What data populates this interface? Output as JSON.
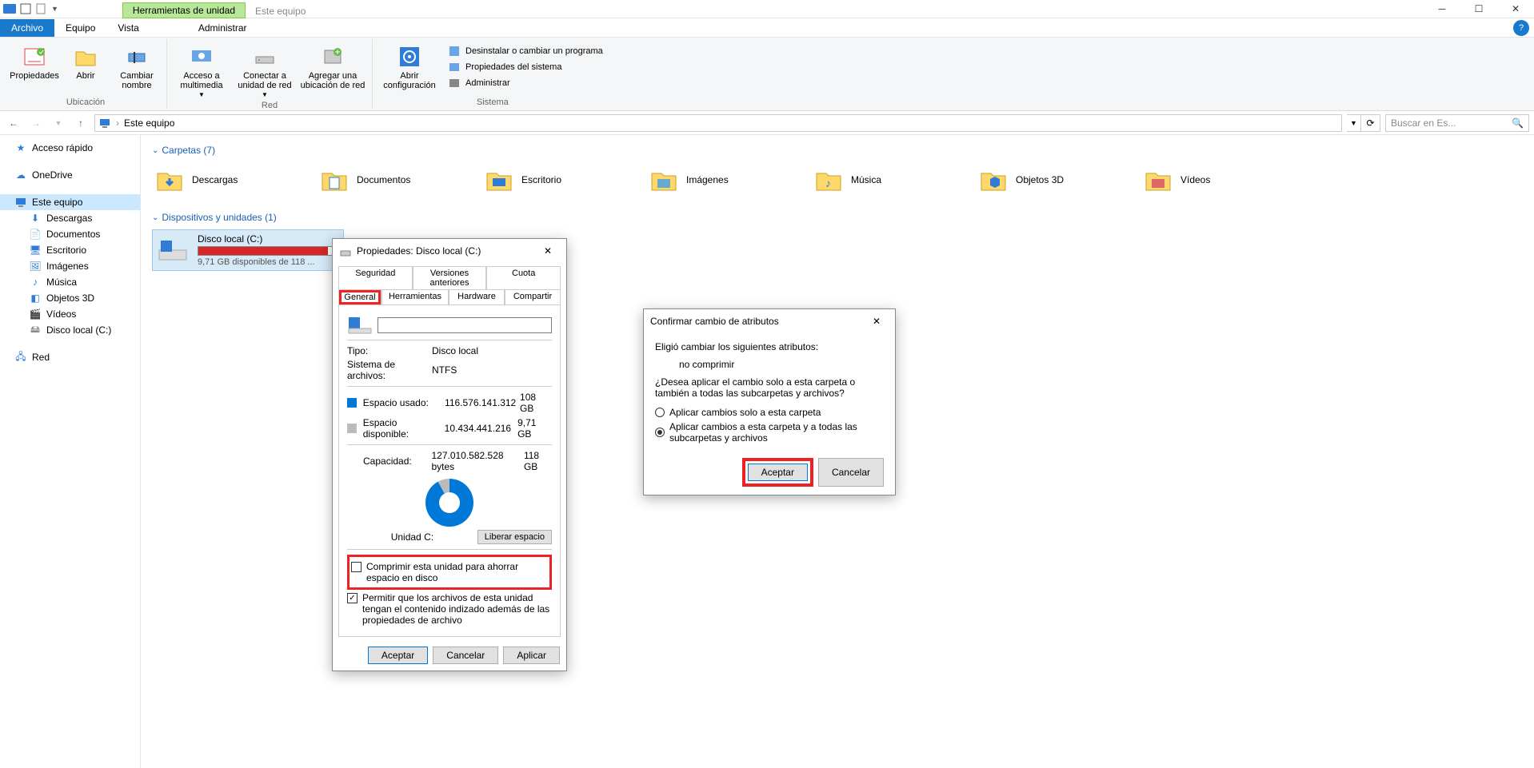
{
  "titlebar": {
    "tools_tab": "Herramientas de unidad",
    "context_label": "Este equipo",
    "manage_label": "Administrar"
  },
  "menutabs": {
    "file": "Archivo",
    "computer": "Equipo",
    "view": "Vista"
  },
  "ribbon": {
    "location": {
      "properties": "Propiedades",
      "open": "Abrir",
      "rename": "Cambiar nombre",
      "group": "Ubicación"
    },
    "network": {
      "media": "Acceso a multimedia",
      "map": "Conectar a unidad de red",
      "add": "Agregar una ubicación de red",
      "group": "Red"
    },
    "system": {
      "settings": "Abrir configuración",
      "uninstall": "Desinstalar o cambiar un programa",
      "sysprops": "Propiedades del sistema",
      "manage": "Administrar",
      "group": "Sistema"
    }
  },
  "address": {
    "crumb": "Este equipo",
    "search_placeholder": "Buscar en Es..."
  },
  "sidebar": {
    "quick": "Acceso rápido",
    "onedrive": "OneDrive",
    "thispc": "Este equipo",
    "downloads": "Descargas",
    "documents": "Documentos",
    "desktop": "Escritorio",
    "pictures": "Imágenes",
    "music": "Música",
    "objects3d": "Objetos 3D",
    "videos": "Vídeos",
    "localdisk": "Disco local (C:)",
    "network": "Red"
  },
  "sections": {
    "folders": "Carpetas (7)",
    "devices": "Dispositivos y unidades (1)"
  },
  "folders": {
    "downloads": "Descargas",
    "documents": "Documentos",
    "desktop": "Escritorio",
    "pictures": "Imágenes",
    "music": "Música",
    "objects3d": "Objetos 3D",
    "videos": "Vídeos"
  },
  "drive": {
    "name": "Disco local (C:)",
    "free": "9,71 GB disponibles de 118 ..."
  },
  "props": {
    "title": "Propiedades: Disco local (C:)",
    "tabs": {
      "security": "Seguridad",
      "prev": "Versiones anteriores",
      "quota": "Cuota",
      "general": "General",
      "tools": "Herramientas",
      "hardware": "Hardware",
      "share": "Compartir"
    },
    "type_label": "Tipo:",
    "type_value": "Disco local",
    "fs_label": "Sistema de archivos:",
    "fs_value": "NTFS",
    "used_label": "Espacio usado:",
    "used_bytes": "116.576.141.312",
    "used_gb": "108 GB",
    "free_label": "Espacio disponible:",
    "free_bytes": "10.434.441.216",
    "free_gb": "9,71 GB",
    "cap_label": "Capacidad:",
    "cap_bytes": "127.010.582.528 bytes",
    "cap_gb": "118 GB",
    "unit_label": "Unidad C:",
    "cleanup": "Liberar espacio",
    "compress": "Comprimir esta unidad para ahorrar espacio en disco",
    "index": "Permitir que los archivos de esta unidad tengan el contenido indizado además de las propiedades de archivo",
    "accept": "Aceptar",
    "cancel": "Cancelar",
    "apply": "Aplicar"
  },
  "confirm": {
    "title": "Confirmar cambio de atributos",
    "chose": "Eligió cambiar los siguientes atributos:",
    "attr": "no comprimir",
    "question": "¿Desea aplicar el cambio solo a esta carpeta o también a todas las subcarpetas y archivos?",
    "opt1": "Aplicar cambios solo a esta carpeta",
    "opt2": "Aplicar cambios a esta carpeta y a todas las subcarpetas y archivos",
    "accept": "Aceptar",
    "cancel": "Cancelar"
  }
}
